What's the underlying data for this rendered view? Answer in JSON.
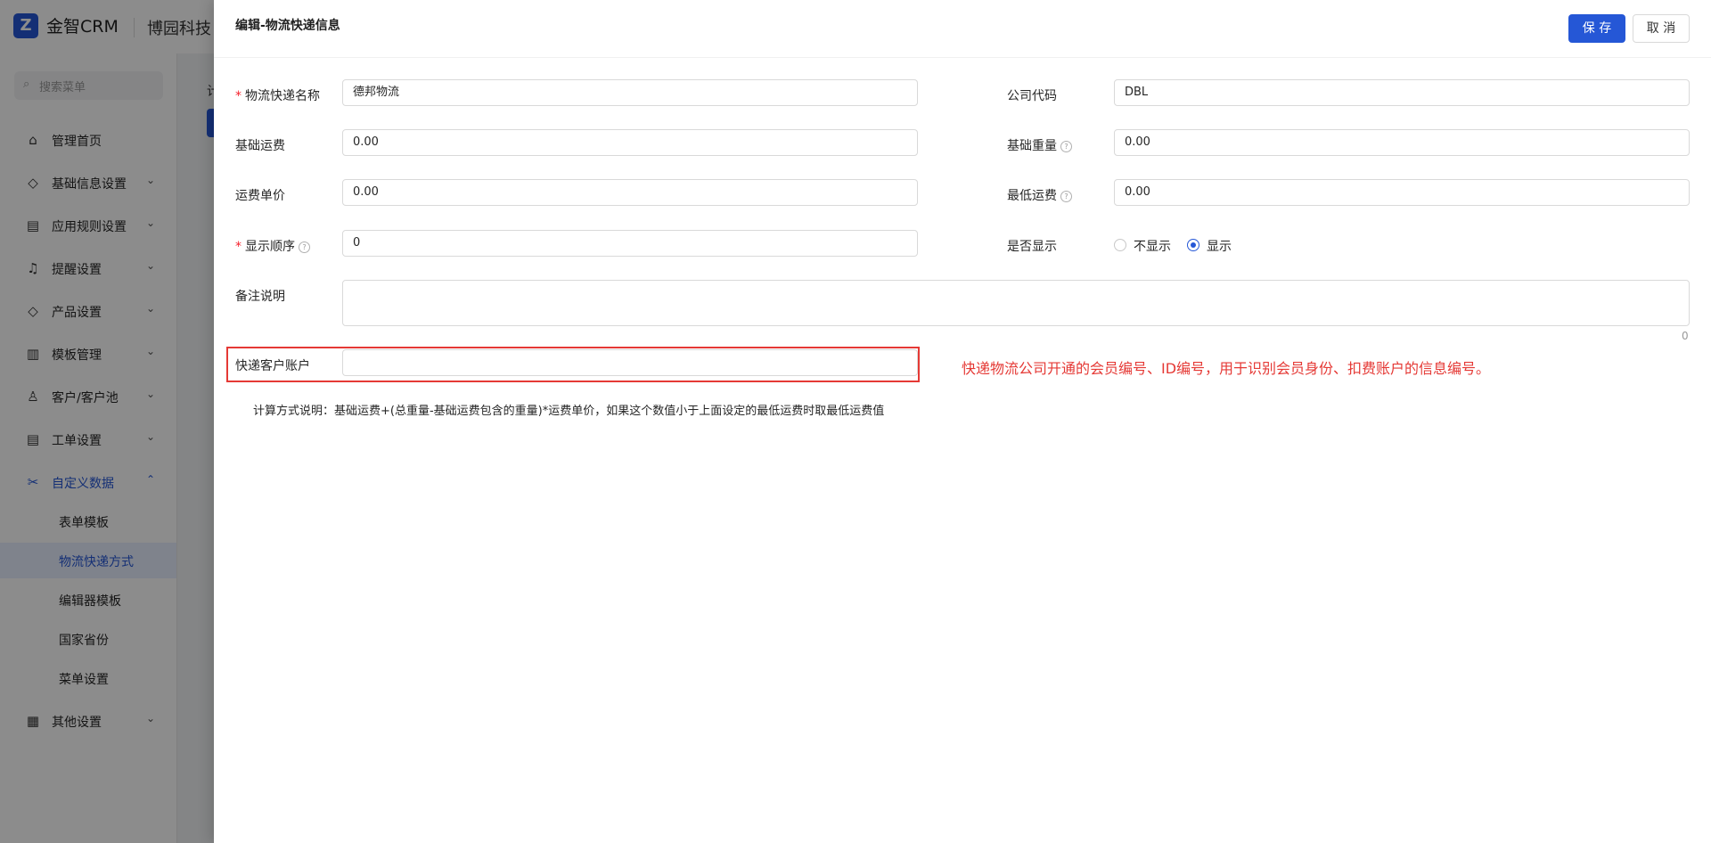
{
  "app": {
    "logo_text": "金智CRM",
    "company": "博园科技"
  },
  "sidebar": {
    "search_placeholder": "搜索菜单",
    "items": [
      {
        "label": "管理首页",
        "icon": "⌂"
      },
      {
        "label": "基础信息设置",
        "icon": "◇"
      },
      {
        "label": "应用规则设置",
        "icon": "▤"
      },
      {
        "label": "提醒设置",
        "icon": "♫"
      },
      {
        "label": "产品设置",
        "icon": "◇"
      },
      {
        "label": "模板管理",
        "icon": "▥"
      },
      {
        "label": "客户/客户池",
        "icon": "♙"
      },
      {
        "label": "工单设置",
        "icon": "▤"
      },
      {
        "label": "自定义数据",
        "icon": "✂"
      }
    ],
    "subitems": [
      {
        "label": "表单模板"
      },
      {
        "label": "物流快递方式"
      },
      {
        "label": "编辑器模板"
      },
      {
        "label": "国家省份"
      },
      {
        "label": "菜单设置"
      }
    ],
    "last_item": {
      "label": "其他设置",
      "icon": "▦"
    }
  },
  "content": {
    "fragment": "计"
  },
  "drawer": {
    "title": "编辑-物流快递信息",
    "save": "保 存",
    "cancel": "取 消",
    "fields": {
      "name": {
        "label": "物流快递名称",
        "value": "德邦物流"
      },
      "company_code": {
        "label": "公司代码",
        "value": "DBL"
      },
      "base_fee": {
        "label": "基础运费",
        "value": "0.00"
      },
      "base_weight": {
        "label": "基础重量",
        "value": "0.00"
      },
      "unit_price": {
        "label": "运费单价",
        "value": "0.00"
      },
      "min_fee": {
        "label": "最低运费",
        "value": "0.00"
      },
      "display_order": {
        "label": "显示顺序",
        "value": "0"
      },
      "visible": {
        "label": "是否显示",
        "options": [
          "不显示",
          "显示"
        ],
        "selected": "显示"
      },
      "remark": {
        "label": "备注说明",
        "value": "",
        "count": "0"
      },
      "account": {
        "label": "快递客户账户",
        "value": ""
      }
    },
    "annotation": "快递物流公司开通的会员编号、ID编号，用于识别会员身份、扣费账户的信息编号。",
    "calc_note": "计算方式说明：基础运费+(总重量-基础运费包含的重量)*运费单价，如果这个数值小于上面设定的最低运费时取最低运费值"
  }
}
